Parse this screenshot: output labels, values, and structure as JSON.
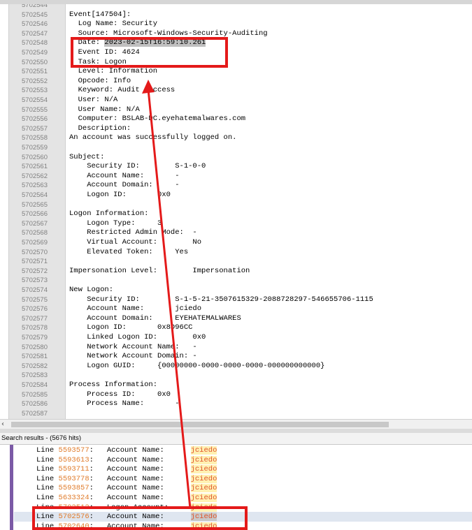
{
  "editor": {
    "lines": [
      {
        "n": "5702544",
        "t": ""
      },
      {
        "n": "5702545",
        "t": "Event[147504]:"
      },
      {
        "n": "5702546",
        "t": "  Log Name: Security"
      },
      {
        "n": "5702547",
        "t": "  Source: Microsoft-Windows-Security-Auditing"
      },
      {
        "n": "5702548",
        "t": "  Date: 2023-02-15T16:59:10.261"
      },
      {
        "n": "5702549",
        "t": "  Event ID: 4624"
      },
      {
        "n": "5702550",
        "t": "  Task: Logon"
      },
      {
        "n": "5702551",
        "t": "  Level: Information"
      },
      {
        "n": "5702552",
        "t": "  Opcode: Info"
      },
      {
        "n": "5702553",
        "t": "  Keyword: Audit Success"
      },
      {
        "n": "5702554",
        "t": "  User: N/A"
      },
      {
        "n": "5702555",
        "t": "  User Name: N/A"
      },
      {
        "n": "5702556",
        "t": "  Computer: BSLAB-DC.eyehatemalwares.com"
      },
      {
        "n": "5702557",
        "t": "  Description:"
      },
      {
        "n": "5702558",
        "t": "An account was successfully logged on."
      },
      {
        "n": "5702559",
        "t": ""
      },
      {
        "n": "5702560",
        "t": "Subject:"
      },
      {
        "n": "5702561",
        "t": "    Security ID:        S-1-0-0"
      },
      {
        "n": "5702562",
        "t": "    Account Name:       -"
      },
      {
        "n": "5702563",
        "t": "    Account Domain:     -"
      },
      {
        "n": "5702564",
        "t": "    Logon ID:       0x0"
      },
      {
        "n": "5702565",
        "t": ""
      },
      {
        "n": "5702566",
        "t": "Logon Information:"
      },
      {
        "n": "5702567",
        "t": "    Logon Type:     3"
      },
      {
        "n": "5702568",
        "t": "    Restricted Admin Mode:  -"
      },
      {
        "n": "5702569",
        "t": "    Virtual Account:        No"
      },
      {
        "n": "5702570",
        "t": "    Elevated Token:     Yes"
      },
      {
        "n": "5702571",
        "t": ""
      },
      {
        "n": "5702572",
        "t": "Impersonation Level:        Impersonation"
      },
      {
        "n": "5702573",
        "t": ""
      },
      {
        "n": "5702574",
        "t": "New Logon:"
      },
      {
        "n": "5702575",
        "t": "    Security ID:        S-1-5-21-3507615329-2088728297-546655706-1115"
      },
      {
        "n": "5702576",
        "t": "    Account Name:       jciedo"
      },
      {
        "n": "5702577",
        "t": "    Account Domain:     EYEHATEMALWARES"
      },
      {
        "n": "5702578",
        "t": "    Logon ID:       0x8D96CC"
      },
      {
        "n": "5702579",
        "t": "    Linked Logon ID:        0x0"
      },
      {
        "n": "5702580",
        "t": "    Network Account Name:   -"
      },
      {
        "n": "5702581",
        "t": "    Network Account Domain: -"
      },
      {
        "n": "5702582",
        "t": "    Logon GUID:     {00000000-0000-0000-0000-000000000000}"
      },
      {
        "n": "5702583",
        "t": ""
      },
      {
        "n": "5702584",
        "t": "Process Information:"
      },
      {
        "n": "5702585",
        "t": "    Process ID:     0x0"
      },
      {
        "n": "5702586",
        "t": "    Process Name:       -"
      },
      {
        "n": "5702587",
        "t": ""
      }
    ],
    "date_prefix": "  Date: ",
    "date_value": "2023-02-15T16:59:10.261"
  },
  "search": {
    "header": "Search results - (5676 hits)",
    "results": [
      {
        "num": "5593577",
        "field": "Account Name:",
        "value": "jciedo"
      },
      {
        "num": "5593613",
        "field": "Account Name:",
        "value": "jciedo"
      },
      {
        "num": "5593711",
        "field": "Account Name:",
        "value": "jciedo"
      },
      {
        "num": "5593778",
        "field": "Account Name:",
        "value": "jciedo"
      },
      {
        "num": "5593857",
        "field": "Account Name:",
        "value": "jciedo"
      },
      {
        "num": "5633324",
        "field": "Account Name:",
        "value": "jciedo"
      },
      {
        "num": "5702512",
        "field": "Logon Account:",
        "value": "jciedo"
      },
      {
        "num": "5702576",
        "field": "Account Name:",
        "value": "jciedo"
      },
      {
        "num": "5702640",
        "field": "Account Name:",
        "value": "jciedo"
      }
    ],
    "line_label": "Line"
  },
  "colors": {
    "annotation": "#e41a1a",
    "line_number": "#e07b2a",
    "hit": "#e0542a"
  }
}
